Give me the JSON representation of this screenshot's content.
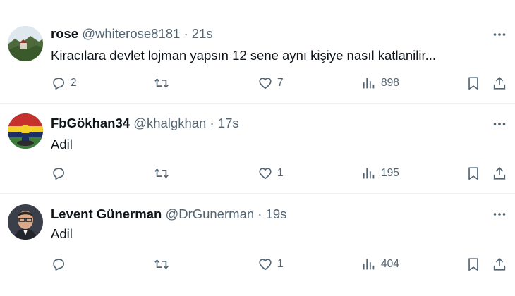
{
  "tweets": [
    {
      "name": "rose",
      "handle": "@whiterose8181",
      "time": "21s",
      "text": "Kiracılara devlet lojman yapsın 12 sene aynı kişiye nasıl katlanilir...",
      "replies": "2",
      "retweets": "",
      "likes": "7",
      "views": "898"
    },
    {
      "name": "FbGökhan34",
      "handle": "@khalgkhan",
      "time": "17s",
      "text": "Adil",
      "replies": "",
      "retweets": "",
      "likes": "1",
      "views": "195"
    },
    {
      "name": "Levent Günerman",
      "handle": "@DrGunerman",
      "time": "19s",
      "text": "Adil",
      "replies": "",
      "retweets": "",
      "likes": "1",
      "views": "404"
    }
  ],
  "separator": "·",
  "icons": {
    "reply": "reply-icon",
    "retweet": "retweet-icon",
    "like": "heart-icon",
    "views": "views-icon",
    "bookmark": "bookmark-icon",
    "share": "share-icon",
    "more": "more-icon"
  },
  "colors": {
    "text": "#0f1419",
    "secondary": "#536471",
    "divider": "#eff3f4"
  }
}
